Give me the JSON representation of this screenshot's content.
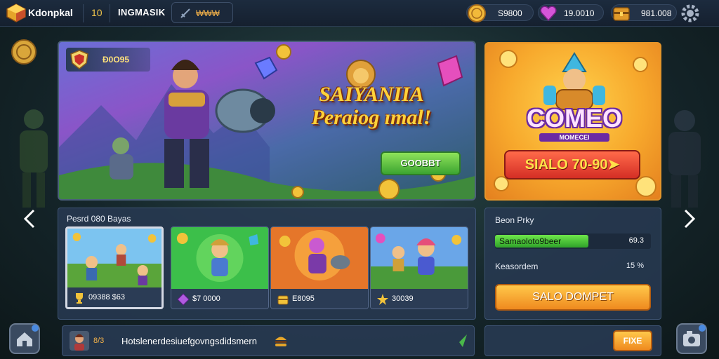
{
  "header": {
    "brand": "Kdonpkal",
    "level": "10",
    "player_name": "INGMASIK",
    "nav_pill_label": "₩₩₩",
    "currencies": [
      {
        "icon": "gold-coin-icon",
        "value": "S9800"
      },
      {
        "icon": "heart-gem-icon",
        "value": "19.0010"
      },
      {
        "icon": "treasure-chest-icon",
        "value": "981.008"
      }
    ],
    "settings_icon": "gear-icon"
  },
  "banner": {
    "badge": "Ð0O95",
    "title_line1": "SAIYANIIA",
    "title_line2": "Peraiog ımal!",
    "button": "GOOBBT"
  },
  "promo": {
    "title": "COMEO",
    "subtitle": "MOMECEI",
    "button": "SIALO 70-90➤"
  },
  "games": {
    "title": "Pesrd 080 Bayas",
    "tiles": [
      {
        "value": "09388 $63",
        "icon": "trophy-icon",
        "selected": true
      },
      {
        "value": "$7 0000",
        "icon": "purple-gem-icon",
        "selected": false
      },
      {
        "value": "E8095",
        "icon": "gold-chest-icon",
        "selected": false
      },
      {
        "value": "30039",
        "icon": "gold-star-icon",
        "selected": false
      }
    ]
  },
  "right_panel": {
    "title": "Beon Prky",
    "progress": {
      "label": "Samaoloto9beer",
      "value": "69.3",
      "fill_fraction": 0.6
    },
    "row_label": "Keasordem",
    "row_value": "15 %",
    "claim_button": "SALO DOMPET"
  },
  "chat": {
    "count": "8/3",
    "message": "Hotslenerdesiuefgovngsdidsmern"
  },
  "friends": {
    "button": "FIXE"
  },
  "colors": {
    "accent_gold": "#f3c64a",
    "accent_green": "#3ca431",
    "accent_orange": "#ef8a1f",
    "accent_red": "#d42e25",
    "panel_bg": "#283a52"
  }
}
